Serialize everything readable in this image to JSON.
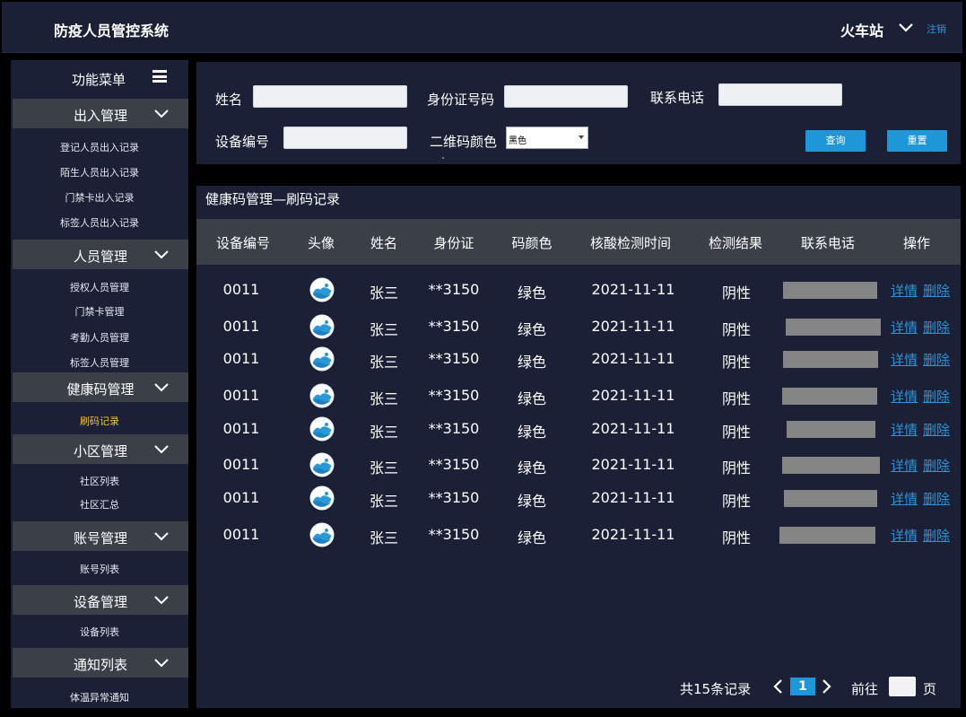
{
  "header": {
    "app_title": "防疫人员管控系统",
    "station": "火车站",
    "logout": "注销"
  },
  "sidebar": {
    "menu_title": "功能菜单",
    "groups": [
      {
        "label": "出入管理",
        "items": [
          "登记人员出入记录",
          "陌生人员出入记录",
          "门禁卡出入记录",
          "标签人员出入记录"
        ]
      },
      {
        "label": "人员管理",
        "items": [
          "授权人员管理",
          "门禁卡管理",
          "考勤人员管理",
          "标签人员管理"
        ]
      },
      {
        "label": "健康码管理",
        "items": [
          "刷码记录"
        ],
        "active_item": "刷码记录"
      },
      {
        "label": "小区管理",
        "items": [
          "社区列表",
          "社区汇总"
        ]
      },
      {
        "label": "账号管理",
        "items": [
          "账号列表"
        ]
      },
      {
        "label": "设备管理",
        "items": [
          "设备列表"
        ]
      },
      {
        "label": "通知列表",
        "items": [
          "体温异常通知"
        ]
      }
    ]
  },
  "search": {
    "name_label": "姓名",
    "id_label": "身份证号码",
    "phone_label": "联系电话",
    "device_label": "设备编号",
    "qr_color_label": "二维码颜色",
    "qr_color_value": "黑色",
    "query_button": "查询",
    "reset_button": "重置"
  },
  "table": {
    "title": "健康码管理—刷码记录",
    "columns": [
      "设备编号",
      "头像",
      "姓名",
      "身份证",
      "码颜色",
      "核酸检测时间",
      "检测结果",
      "联系电话",
      "操作"
    ],
    "rows": [
      {
        "device": "0011",
        "name": "张三",
        "id": "**3150",
        "color": "绿色",
        "test_time": "2021-11-11",
        "result": "阴性",
        "detail": "详情",
        "delete": "删除"
      },
      {
        "device": "0011",
        "name": "张三",
        "id": "**3150",
        "color": "绿色",
        "test_time": "2021-11-11",
        "result": "阴性",
        "detail": "详情",
        "delete": "删除"
      },
      {
        "device": "0011",
        "name": "张三",
        "id": "**3150",
        "color": "绿色",
        "test_time": "2021-11-11",
        "result": "阴性",
        "detail": "详情",
        "delete": "删除"
      },
      {
        "device": "0011",
        "name": "张三",
        "id": "**3150",
        "color": "绿色",
        "test_time": "2021-11-11",
        "result": "阴性",
        "detail": "详情",
        "delete": "删除"
      },
      {
        "device": "0011",
        "name": "张三",
        "id": "**3150",
        "color": "绿色",
        "test_time": "2021-11-11",
        "result": "阴性",
        "detail": "详情",
        "delete": "删除"
      },
      {
        "device": "0011",
        "name": "张三",
        "id": "**3150",
        "color": "绿色",
        "test_time": "2021-11-11",
        "result": "阴性",
        "detail": "详情",
        "delete": "删除"
      },
      {
        "device": "0011",
        "name": "张三",
        "id": "**3150",
        "color": "绿色",
        "test_time": "2021-11-11",
        "result": "阴性",
        "detail": "详情",
        "delete": "删除"
      },
      {
        "device": "0011",
        "name": "张三",
        "id": "**3150",
        "color": "绿色",
        "test_time": "2021-11-11",
        "result": "阴性",
        "detail": "详情",
        "delete": "删除"
      }
    ]
  },
  "pagination": {
    "total": "共15条记录",
    "current_page": "1",
    "goto_label": "前往",
    "unit": "页"
  },
  "colors": {
    "panel": "#1b2036",
    "bar": "#3b3f48",
    "accent": "#1e97d8",
    "link": "#2f92d6",
    "active": "#f5c23b"
  }
}
